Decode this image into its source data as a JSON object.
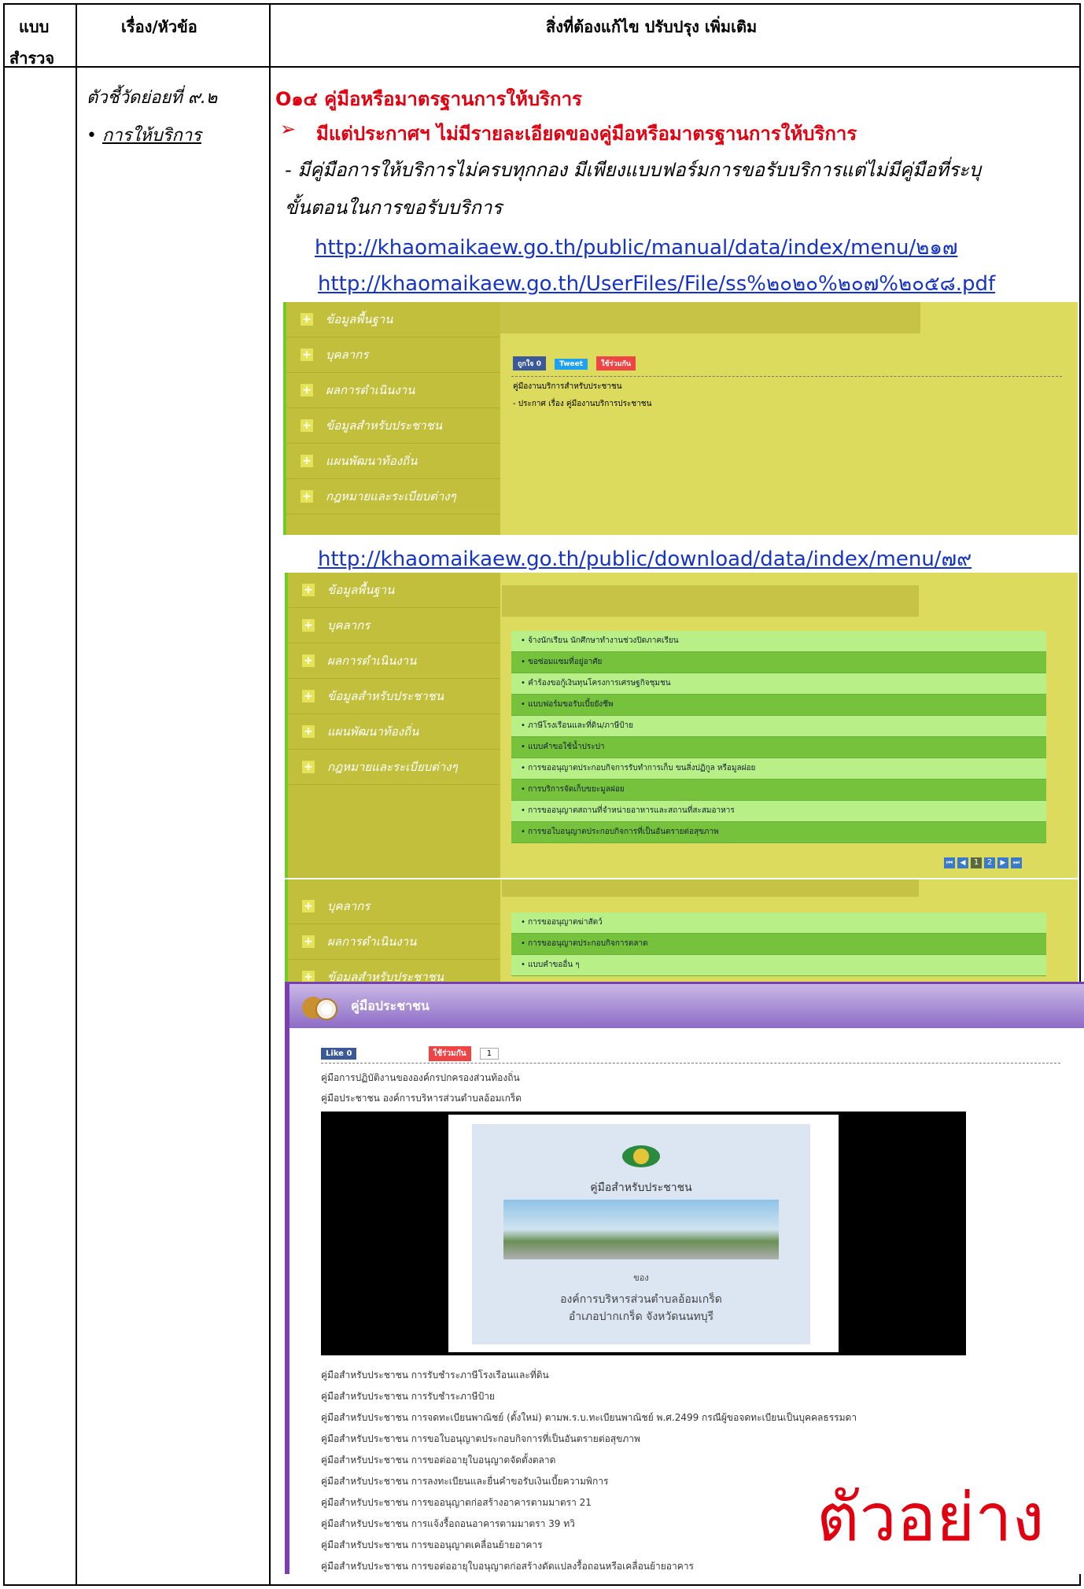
{
  "header": {
    "col1": "แบบ",
    "col1b": "สำรวจ",
    "col2": "เรื่อง/หัวข้อ",
    "col3": "สิ่งที่ต้องแก้ไข ปรับปรุง เพิ่มเติม"
  },
  "topic": {
    "indicator": "ตัวชี้วัดย่อยที่ ๙.๒",
    "bullet": "• ",
    "item": "การให้บริการ"
  },
  "content": {
    "item_title": "O๑๔ คู่มือหรือมาตรฐานการให้บริการ",
    "arrow": "➢",
    "point": "มีแต่ประกาศฯ ไม่มีรายละเอียดของคู่มือหรือมาตรฐานการให้บริการ",
    "note1": "- มีคู่มือการให้บริการไม่ครบทุกกอง มีเพียงแบบฟอร์มการขอรับบริการแต่ไม่มีคู่มือที่ระบุ",
    "note2": "ขั้นตอนในการขอรับบริการ",
    "link1": "http://khaomaikaew.go.th/public/manual/data/index/menu/๒๑๗",
    "link2": "http://khaomaikaew.go.th/UserFiles/File/ss%๒๐๒๐%๒๐๗%๒๐๕๘.pdf",
    "link3": "http://khaomaikaew.go.th/public/download/data/index/menu/๗๙"
  },
  "screenshot1": {
    "menu": [
      "ข้อมูลพื้นฐาน",
      "บุคลากร",
      "ผลการดำเนินงาน",
      "ข้อมูลสำหรับประชาชน",
      "แผนพัฒนาท้องถิ่น",
      "กฎหมายและระเบียบต่างๆ"
    ],
    "like": "ถูกใจ 0",
    "tweet": "Tweet",
    "share": "ใช้ร่วมกัน",
    "heading": "คู่มืองานบริการสำหรับประชาชน",
    "line": "- ประกาศ เรื่อง คู่มืองานบริการประชาชน"
  },
  "screenshot2": {
    "menu": [
      "ข้อมูลพื้นฐาน",
      "บุคลากร",
      "ผลการดำเนินงาน",
      "ข้อมูลสำหรับประชาชน",
      "แผนพัฒนาท้องถิ่น",
      "กฎหมายและระเบียบต่างๆ"
    ],
    "items": [
      "• จ้างนักเรียน นักศึกษาทำงานช่วงปิดภาคเรียน",
      "• ขอซ่อมแซมที่อยู่อาศัย",
      "• คำร้องขอกู้เงินทุนโครงการเศรษฐกิจชุมชน",
      "• แบบฟอร์มขอรับเบี้ยยังชีพ",
      "• ภาษีโรงเรือนและที่ดิน/ภาษีป้าย",
      "• แบบคำขอใช้น้ำประปา",
      "• การขออนุญาตประกอบกิจการรับทำการเก็บ ขนสิ่งปฏิกูล หรือมูลฝอย",
      "• การบริการจัดเก็บขยะมูลฝอย",
      "• การขออนุญาตสถานที่จำหน่ายอาหารและสถานที่สะสมอาหาร",
      "• การขอใบอนุญาตประกอบกิจการที่เป็นอันตรายต่อสุขภาพ"
    ],
    "pages": [
      "1",
      "2"
    ]
  },
  "screenshot3": {
    "menu": [
      "บุคลากร",
      "ผลการดำเนินงาน",
      "ข้อมูลสำหรับประชาชน"
    ],
    "items": [
      "• การขออนุญาตฆ่าสัตว์",
      "• การขออนุญาตประกอบกิจการตลาด",
      "• แบบคำขออื่น ๆ"
    ]
  },
  "screenshot4": {
    "title": "คู่มือประชาชน",
    "like": "Like 0",
    "share": "ใช้ร่วมกัน",
    "share_count": "1",
    "line1": "คู่มือการปฏิบัติงานขององค์กรปกครองส่วนท้องถิ่น",
    "line2": "คู่มือประชาชน องค์การบริหารส่วนตำบลอ้อมเกร็ด",
    "cover_title": "คู่มือสำหรับประชาชน",
    "cover_of": "ของ",
    "cover_org": "องค์การบริหารส่วนตำบลอ้อมเกร็ด",
    "cover_addr": "อำเภอปากเกร็ด  จังหวัดนนทบุรี",
    "list": [
      "คู่มือสำหรับประชาชน การรับชำระภาษีโรงเรือนและที่ดิน",
      "คู่มือสำหรับประชาชน การรับชำระภาษีป้าย",
      "คู่มือสำหรับประชาชน การจดทะเบียนพาณิชย์ (ตั้งใหม่) ตามพ.ร.บ.ทะเบียนพาณิชย์ พ.ศ.2499 กรณีผู้ขอจดทะเบียนเป็นบุคคลธรรมดา",
      "คู่มือสำหรับประชาชน การขอใบอนุญาตประกอบกิจการที่เป็นอันตรายต่อสุขภาพ",
      "คู่มือสำหรับประชาชน การขอต่ออายุใบอนุญาตจัดตั้งตลาด",
      "คู่มือสำหรับประชาชน การลงทะเบียนและยื่นคำขอรับเงินเบี้ยความพิการ",
      "คู่มือสำหรับประชาชน การขออนุญาตก่อสร้างอาคารตามมาตรา 21",
      "คู่มือสำหรับประชาชน การแจ้งรื้อถอนอาคารตามมาตรา 39 ทวิ",
      "คู่มือสำหรับประชาชน การขออนุญาตเคลื่อนย้ายอาคาร",
      "คู่มือสำหรับประชาชน การขอต่ออายุใบอนุญาตก่อสร้างดัดแปลงรื้อถอนหรือเคลื่อนย้ายอาคาร"
    ],
    "watermark": "ตัวอย่าง"
  },
  "colors": {
    "red": "#e0000f",
    "link": "#1533c9",
    "side": "#c1bf3c",
    "panel": "#dcdb5e"
  }
}
